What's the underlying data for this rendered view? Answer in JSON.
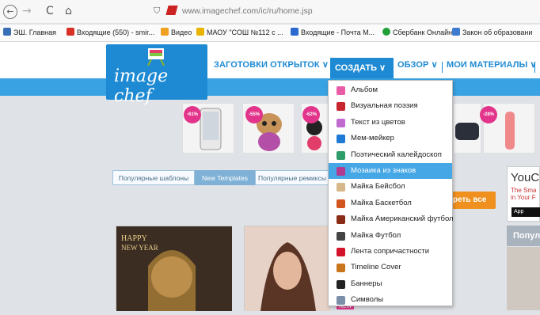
{
  "browser": {
    "back": "←",
    "forward": "→",
    "reload": "C",
    "home": "⌂",
    "url": "www.imagechef.com/ic/ru/home.jsp"
  },
  "bookmarks": [
    {
      "label": "ЭШ. Главная",
      "icon": "school-icon",
      "color": "#3a6fb5"
    },
    {
      "label": "Входящие (550) - smir...",
      "icon": "gmail-icon",
      "color": "#d93025"
    },
    {
      "label": "Видео",
      "icon": "video-icon",
      "color": "#f0a020"
    },
    {
      "label": "МАОУ \"СОШ №112 с ...",
      "icon": "school-site-icon",
      "color": "#e8b400"
    },
    {
      "label": "Входящие - Почта М...",
      "icon": "mail-icon",
      "color": "#2a6ad0"
    },
    {
      "label": "Сбербанк Онлайн",
      "icon": "sberbank-icon",
      "color": "#21a038"
    },
    {
      "label": "Закон об образовани",
      "icon": "law-icon",
      "color": "#3c7bd0"
    }
  ],
  "site": {
    "logo_text": "image chef",
    "menu": {
      "cards": "ЗАГОТОВКИ ОТКРЫТОК ∨",
      "create": "СОЗДАТЬ ∨",
      "browse": "ОБЗОР ∨",
      "mine": "МОИ МАТЕРИАЛЫ ∨"
    },
    "badges": [
      "-61%",
      "-55%",
      "-62%",
      "-28%"
    ],
    "tabs": {
      "popular": "Популярные шаблоны",
      "new": "New Templates",
      "remixes": "Популярные ремиксы"
    },
    "see_all": "реть все",
    "side": {
      "title": "YouC",
      "line1": "The Sma",
      "line2": "in Your F",
      "app": " App",
      "popular": "Попул"
    },
    "card_text": [
      "HAPPY",
      "NEW YEAR"
    ],
    "new_tag": "NEW"
  },
  "dropdown": {
    "items": [
      {
        "label": "Альбом",
        "icon": "album-icon",
        "color": "#e85ca8"
      },
      {
        "label": "Визуальная поэзия",
        "icon": "poetry-icon",
        "color": "#c8262f"
      },
      {
        "label": "Текст из цветов",
        "icon": "flowers-icon",
        "color": "#c06ad0"
      },
      {
        "label": "Мем-мейкер",
        "icon": "meme-icon",
        "color": "#1f7ad6"
      },
      {
        "label": "Поэтический калейдоскоп",
        "icon": "kaleidoscope-icon",
        "color": "#2f9c6b"
      },
      {
        "label": "Мозаика из знаков",
        "icon": "mosaic-icon",
        "color": "#b23a8f",
        "highlighted": true
      },
      {
        "label": "Майка Бейсбол",
        "icon": "baseball-icon",
        "color": "#d6b88a"
      },
      {
        "label": "Майка Баскетбол",
        "icon": "basketball-icon",
        "color": "#d2551f"
      },
      {
        "label": "Майка Американский футбол",
        "icon": "football-icon",
        "color": "#8a2b16"
      },
      {
        "label": "Майка Футбол",
        "icon": "soccer-icon",
        "color": "#444444"
      },
      {
        "label": "Лента сопричастности",
        "icon": "ribbon-icon",
        "color": "#d3122c"
      },
      {
        "label": "Timeline Cover",
        "icon": "timeline-icon",
        "color": "#c8751e"
      },
      {
        "label": "Баннеры",
        "icon": "banner-icon",
        "color": "#222222"
      },
      {
        "label": "Символы",
        "icon": "symbols-icon",
        "color": "#7b8fa8"
      }
    ]
  }
}
